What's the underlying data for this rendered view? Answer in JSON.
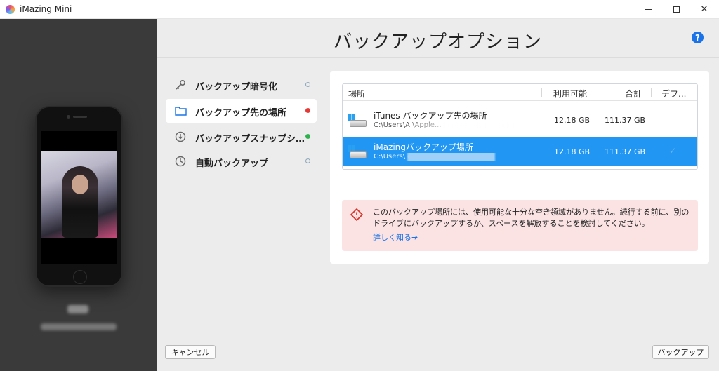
{
  "window": {
    "title": "iMazing Mini",
    "minimize_icon": "minimize-icon",
    "maximize_icon": "maximize-icon",
    "close_icon": "close-icon"
  },
  "page": {
    "title": "バックアップオプション",
    "help_label": "?"
  },
  "sidebar": {
    "items": [
      {
        "label": "バックアップ暗号化",
        "icon": "key-icon",
        "status": "hollow"
      },
      {
        "label": "バックアップ先の場所",
        "icon": "folder-icon",
        "status": "red",
        "selected": true
      },
      {
        "label": "バックアップスナップショット",
        "icon": "snapshot-icon",
        "status": "green"
      },
      {
        "label": "自動バックアップ",
        "icon": "clock-icon",
        "status": "hollow"
      }
    ]
  },
  "table": {
    "headers": {
      "location": "場所",
      "free": "利用可能",
      "total": "合計",
      "default": "デフ..."
    },
    "rows": [
      {
        "name": "iTunes バックアップ先の場所",
        "path": "C:\\Users\\A                                       \\Apple...",
        "free": "12.18 GB",
        "total": "111.37 GB",
        "selected": false
      },
      {
        "name": "iMazingバックアップ場所",
        "path": "C:\\Users\\                                       oaming\\iMazi...",
        "free": "12.18 GB",
        "total": "111.37 GB",
        "selected": true
      }
    ]
  },
  "warning": {
    "text": "このバックアップ場所には、使用可能な十分な空き領域がありません。続行する前に、別のドライブにバックアップするか、スペースを解放することを検討してください。",
    "link": "詳しく知る➔"
  },
  "buttons": {
    "cancel": "キャンセル",
    "backup": "バックアップ"
  },
  "colors": {
    "accent": "#2196f3",
    "warning_bg": "#fbe3e4",
    "status_red": "#e53935",
    "status_green": "#2eb24d"
  }
}
